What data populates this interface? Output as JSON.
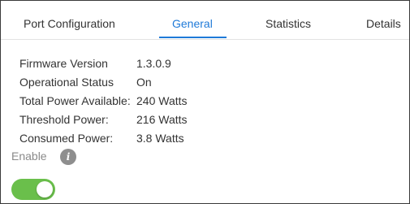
{
  "tabs": [
    {
      "label": "Port Configuration",
      "active": false
    },
    {
      "label": "General",
      "active": true
    },
    {
      "label": "Statistics",
      "active": false
    },
    {
      "label": "Details",
      "active": false
    }
  ],
  "info": [
    {
      "label": "Firmware Version",
      "value": "1.3.0.9"
    },
    {
      "label": "Operational Status",
      "value": "On"
    },
    {
      "label": "Total Power Available:",
      "value": "240 Watts"
    },
    {
      "label": "Threshold Power:",
      "value": "216 Watts"
    },
    {
      "label": "Consumed Power:",
      "value": "3.8 Watts"
    }
  ],
  "enable": {
    "label": "Enable",
    "info_icon": "i",
    "toggle_on": true
  },
  "colors": {
    "accent": "#1f7ad8",
    "toggle_on": "#6abf4b",
    "info_icon_bg": "#8e8e8e"
  }
}
